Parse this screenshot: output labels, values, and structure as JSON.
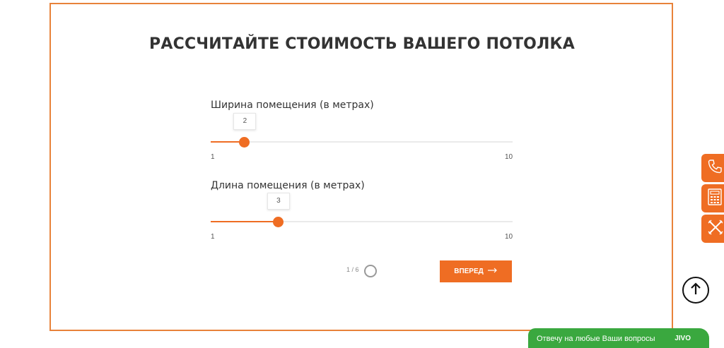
{
  "title": "РАССЧИТАЙТЕ СТОИМОСТЬ ВАШЕГО ПОТОЛКА",
  "sliders": [
    {
      "label": "Ширина помещения (в метрах)",
      "value": 2,
      "value_text": "2",
      "min": 1,
      "max": 10,
      "min_text": "1",
      "max_text": "10"
    },
    {
      "label": "Длина помещения (в метрах)",
      "value": 3,
      "value_text": "3",
      "min": 1,
      "max": 10,
      "min_text": "1",
      "max_text": "10"
    }
  ],
  "pager": {
    "text": "1 / 6"
  },
  "next_button": {
    "label": "ВПЕРЕД"
  },
  "side_buttons": [
    "phone-icon",
    "calculator-icon",
    "tools-icon"
  ],
  "chat": {
    "text": "Отвечу на любые Ваши вопросы",
    "brand": "JIVO"
  },
  "colors": {
    "accent": "#ef6d23",
    "frame": "#e8823a",
    "chat": "#3aa83f"
  }
}
